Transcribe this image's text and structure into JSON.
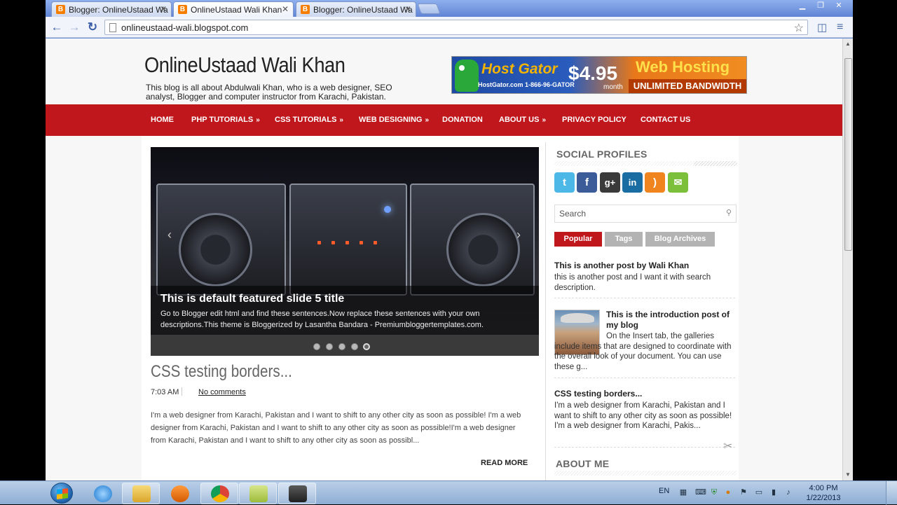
{
  "browser": {
    "tabs": [
      {
        "label": "Blogger: OnlineUstaad Wa"
      },
      {
        "label": "OnlineUstaad Wali Khan"
      },
      {
        "label": "Blogger: OnlineUstaad Wa"
      }
    ],
    "address": "onlineustaad-wali.blogspot.com",
    "icons": {
      "back": "back-arrow-icon",
      "forward": "forward-arrow-icon",
      "reload": "reload-icon",
      "star": "bookmark-star-icon",
      "menu": "wrench-menu-icon"
    }
  },
  "site": {
    "title": "OnlineUstaad Wali Khan",
    "description": "This blog is all about Abdulwali Khan, who is a web designer, SEO analyst, Blogger and computer instructor from Karachi, Pakistan."
  },
  "ad": {
    "brand": "Host Gator",
    "phone": "HostGator.com 1-866-96-GATOR",
    "price": "$4.95",
    "period": "month",
    "headline": "Web Hosting",
    "tagline": "UNLIMITED BANDWIDTH"
  },
  "nav": {
    "items": [
      {
        "label": "HOME",
        "submenu": false
      },
      {
        "label": "PHP TUTORIALS",
        "submenu": true
      },
      {
        "label": "CSS TUTORIALS",
        "submenu": true
      },
      {
        "label": "WEB DESIGNING",
        "submenu": true
      },
      {
        "label": "DONATION",
        "submenu": false
      },
      {
        "label": "ABOUT US",
        "submenu": true
      },
      {
        "label": "PRIVACY POLICY",
        "submenu": false
      },
      {
        "label": "CONTACT US",
        "submenu": false
      }
    ],
    "submenu_glyph": "»"
  },
  "slider": {
    "title": "This is default featured slide 5 title",
    "text": "Go to Blogger edit html and find these sentences.Now replace these sentences with your own descriptions.This theme is Bloggerized by Lasantha Bandara - Premiumbloggertemplates.com.",
    "slide_count": 5,
    "active_slide": 5,
    "prev_glyph": "‹",
    "next_glyph": "›"
  },
  "post": {
    "title": "CSS testing borders...",
    "time": "7:03 AM",
    "comments": "No comments",
    "body": "I'm a web designer from Karachi, Pakistan and I want to shift to any other city as soon as possible! I'm a web designer from Karachi, Pakistan and I want to shift to any other city as soon as possible!I'm a web designer from Karachi, Pakistan and I want to shift to any other city as soon as possibl...",
    "read_more": "READ MORE"
  },
  "sidebar": {
    "social_title": "SOCIAL PROFILES",
    "social_icons": [
      {
        "name": "twitter-icon",
        "glyph": "t",
        "color": "#4cb8e8"
      },
      {
        "name": "facebook-icon",
        "glyph": "f",
        "color": "#3b5b99"
      },
      {
        "name": "google-plus-icon",
        "glyph": "g+",
        "color": "#3a3a3a"
      },
      {
        "name": "linkedin-icon",
        "glyph": "in",
        "color": "#1a6da3"
      },
      {
        "name": "rss-icon",
        "glyph": ")",
        "color": "#f0841e"
      },
      {
        "name": "email-icon",
        "glyph": "✉",
        "color": "#7bbf3a"
      }
    ],
    "search_placeholder": "Search",
    "tabs": [
      {
        "label": "Popular",
        "color": "#c0171c"
      },
      {
        "label": "Tags",
        "color": "#b3b3b3"
      },
      {
        "label": "Blog Archives",
        "color": "#b3b3b3"
      }
    ],
    "popular": [
      {
        "title": "This is another post by Wali Khan",
        "text": "this is another post and I want it with search description."
      },
      {
        "title": "This is the introduction post of my blog",
        "text": "On the Insert tab, the galleries include items that are designed to coordinate with the overall look of your document. You can use these g..."
      },
      {
        "title": "CSS testing borders...",
        "text": "I'm a web designer from Karachi, Pakistan and I want to shift to any other city as soon as possible! I'm a web designer from Karachi, Pakis..."
      }
    ],
    "about_title": "ABOUT ME"
  },
  "taskbar": {
    "language": "EN",
    "time": "4:00 PM",
    "date": "1/22/2013",
    "apps": [
      {
        "name": "internet-explorer-icon"
      },
      {
        "name": "file-explorer-icon"
      },
      {
        "name": "media-player-icon"
      },
      {
        "name": "chrome-icon"
      },
      {
        "name": "notes-icon"
      },
      {
        "name": "camtasia-icon"
      }
    ]
  }
}
